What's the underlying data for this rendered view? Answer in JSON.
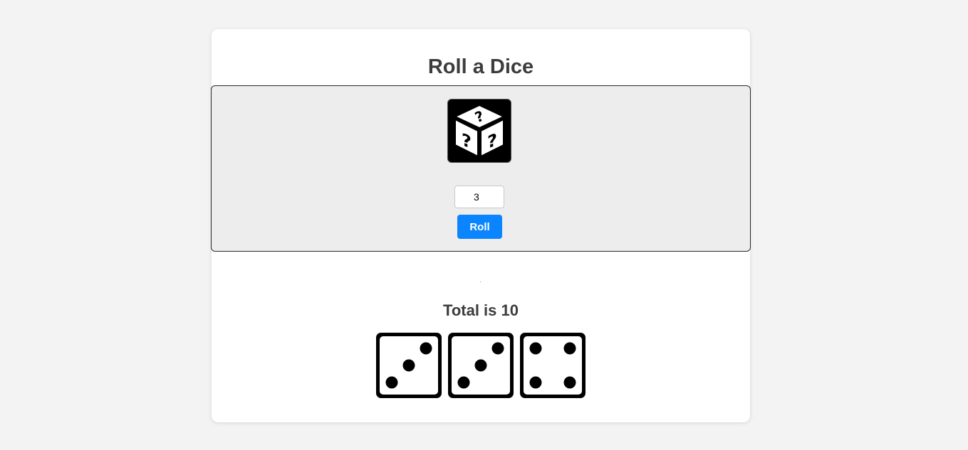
{
  "page": {
    "title": "Roll a Dice"
  },
  "controls": {
    "dice_count": "3",
    "roll_label": "Roll"
  },
  "result": {
    "total_text": "Total is 10",
    "dice_faces": [
      3,
      3,
      4
    ]
  },
  "colors": {
    "background": "#f3f3f3",
    "card": "#ffffff",
    "panel": "#ededed",
    "accent": "#0a84ff",
    "text": "#3d3d3d"
  },
  "icons": {
    "mystery": "question-dice-icon"
  }
}
